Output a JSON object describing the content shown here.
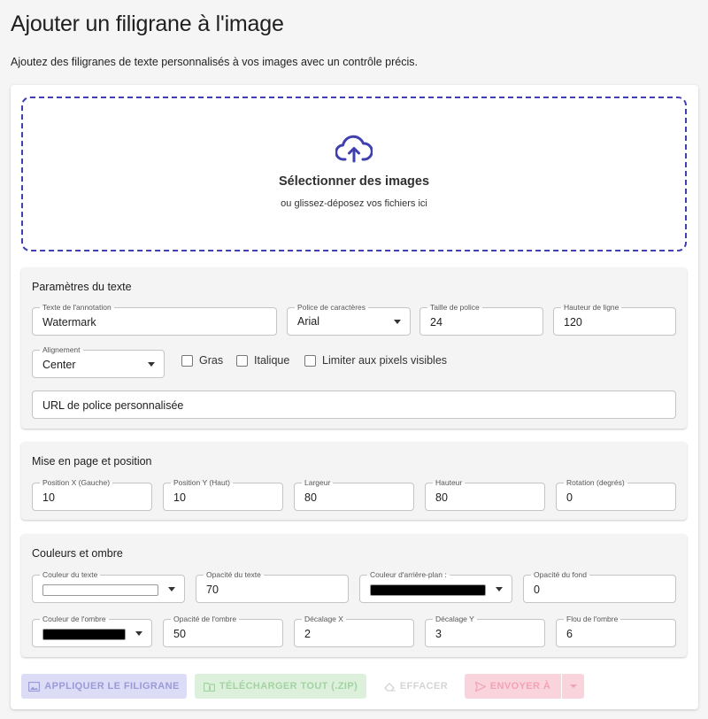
{
  "page": {
    "title": "Ajouter un filigrane à l'image",
    "subtitle": "Ajoutez des filigranes de texte personnalisés à vos images avec un contrôle précis."
  },
  "dropzone": {
    "icon": "cloud-upload-icon",
    "title": "Sélectionner des images",
    "subtitle": "ou glissez-déposez vos fichiers ici"
  },
  "text_params": {
    "title": "Paramètres du texte",
    "annotation_text": {
      "label": "Texte de l'annotation",
      "value": "Watermark"
    },
    "font": {
      "label": "Police de caractères",
      "value": "Arial"
    },
    "font_size": {
      "label": "Taille de police",
      "value": "24"
    },
    "line_height": {
      "label": "Hauteur de ligne",
      "value": "120"
    },
    "alignment": {
      "label": "Alignement",
      "value": "Center"
    },
    "bold_label": "Gras",
    "italic_label": "Italique",
    "limit_label": "Limiter aux pixels visibles",
    "custom_font_url": {
      "placeholder": "URL de police personnalisée"
    }
  },
  "layout": {
    "title": "Mise en page et position",
    "pos_x": {
      "label": "Position X (Gauche)",
      "value": "10"
    },
    "pos_y": {
      "label": "Position Y (Haut)",
      "value": "10"
    },
    "width": {
      "label": "Largeur",
      "value": "80"
    },
    "height": {
      "label": "Hauteur",
      "value": "80"
    },
    "rotation": {
      "label": "Rotation (degrés)",
      "value": "0"
    }
  },
  "colors": {
    "title": "Couleurs et ombre",
    "text_color": {
      "label": "Couleur du texte",
      "color": "#ffffff"
    },
    "text_opacity": {
      "label": "Opacité du texte",
      "value": "70"
    },
    "bg_color": {
      "label": "Couleur d'arrière-plan :",
      "color": "#000000"
    },
    "bg_opacity": {
      "label": "Opacité du fond",
      "value": "0"
    },
    "shadow_color": {
      "label": "Couleur de l'ombre",
      "color": "#000000"
    },
    "shadow_opacity": {
      "label": "Opacité de l'ombre",
      "value": "50"
    },
    "offset_x": {
      "label": "Décalage X",
      "value": "2"
    },
    "offset_y": {
      "label": "Décalage Y",
      "value": "3"
    },
    "blur": {
      "label": "Flou de l'ombre",
      "value": "6"
    }
  },
  "actions": {
    "apply": "APPLIQUER LE FILIGRANE",
    "download": "TÉLÉCHARGER TOUT (.ZIP)",
    "clear": "EFFACER",
    "send": "ENVOYER À"
  },
  "theme": {
    "accent": "#3f3fb0",
    "apply_bg": "#dcdcf7",
    "apply_fg": "#9a9ad8",
    "download_bg": "#dcf0dc",
    "download_fg": "#a3d3a3",
    "send_bg": "#f9d4dd",
    "send_fg": "#f2a2b6"
  }
}
